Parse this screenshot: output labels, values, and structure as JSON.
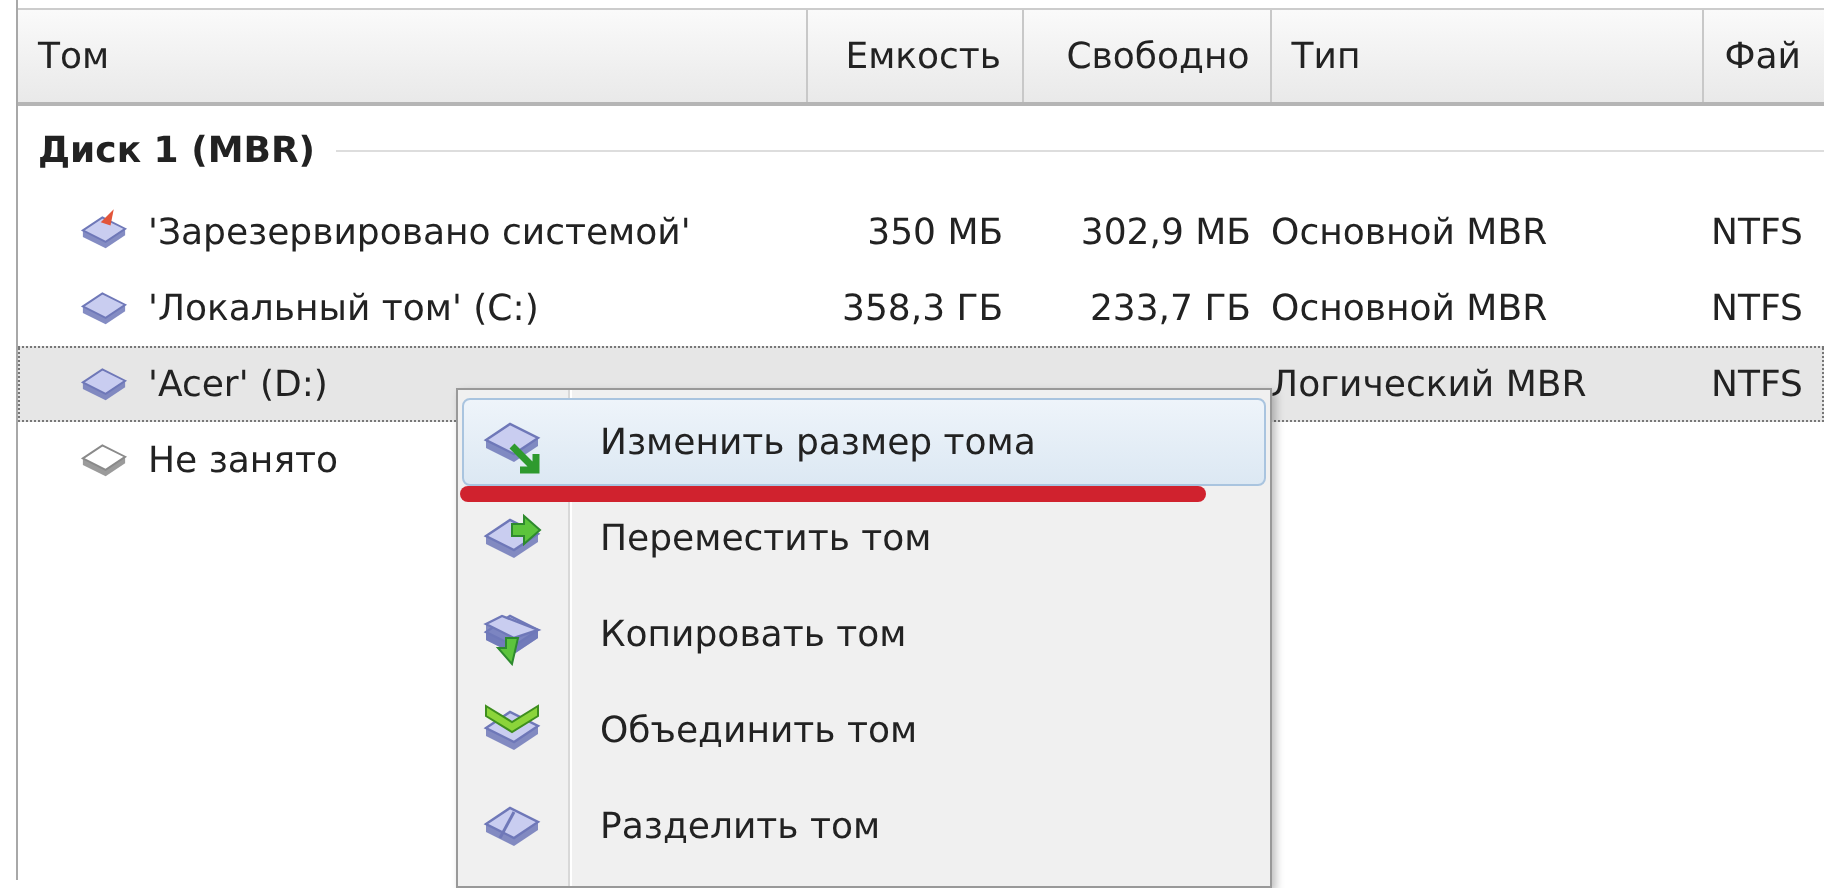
{
  "columns": [
    {
      "label": "Том"
    },
    {
      "label": "Емкость"
    },
    {
      "label": "Свободно"
    },
    {
      "label": "Тип"
    },
    {
      "label": "Фай"
    }
  ],
  "disks": [
    {
      "title": "Диск 1 (MBR)",
      "volumes": [
        {
          "kind": "system",
          "name": "'Зарезервировано системой'",
          "capacity": "350 МБ",
          "free": "302,9 МБ",
          "type": "Основной MBR",
          "fs": "NTFS",
          "selected": false
        },
        {
          "kind": "volume",
          "name": "'Локальный том' (C:)",
          "capacity": "358,3 ГБ",
          "free": "233,7 ГБ",
          "type": "Основной MBR",
          "fs": "NTFS",
          "selected": false
        },
        {
          "kind": "volume",
          "name": "'Acer' (D:)",
          "type": "Логический MBR",
          "fs": "NTFS",
          "selected": true
        },
        {
          "kind": "unallocated",
          "name": "Не занято",
          "selected": false
        }
      ]
    }
  ],
  "context_menu": {
    "items": [
      {
        "kind": "resize",
        "label": "Изменить размер тома",
        "selected": true
      },
      {
        "kind": "move",
        "label": "Переместить том",
        "selected": false
      },
      {
        "kind": "copy",
        "label": "Копировать том",
        "selected": false
      },
      {
        "kind": "merge",
        "label": "Объединить том",
        "selected": false
      },
      {
        "kind": "split",
        "label": "Разделить том",
        "selected": false
      }
    ]
  },
  "annotation": {
    "kind": "underline"
  }
}
